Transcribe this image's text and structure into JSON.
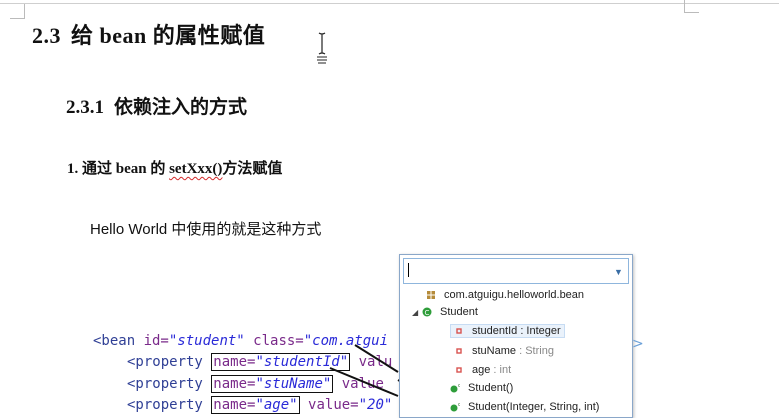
{
  "doc": {
    "heading1": {
      "num": "2.3",
      "text": "给 bean 的属性赋值"
    },
    "heading2": {
      "num": "2.3.1",
      "text": "依赖注入的方式"
    },
    "heading3": {
      "prefix": "1. 通过 bean 的 ",
      "method": "setXxx()",
      "suffix": "方法赋值"
    },
    "paragraph": "Hello World 中使用的就是这种方式"
  },
  "code": {
    "line1": {
      "open": "<bean ",
      "attr1": "id=",
      "val1": "\"student\"",
      "attr2": " class=",
      "val2": "\"com.atgui"
    },
    "line2": {
      "open": "<property ",
      "attr": "name=",
      "val": "\"studentId\"",
      "rest": " valu"
    },
    "line3": {
      "open": "<property ",
      "attr": "name=",
      "val": "\"stuName\"",
      "rest": " value"
    },
    "line4": {
      "open": "<property ",
      "attr": "name=",
      "val": "\"age\"",
      "rest": " value=",
      "val2": "\"20\""
    }
  },
  "popup": {
    "search_value": "",
    "items": [
      {
        "label": "com.atguigu.helloworld.bean",
        "icon": "package-icon"
      },
      {
        "label": "Student",
        "icon": "class-icon"
      },
      {
        "name": "studentId",
        "type": " : Integer",
        "icon": "private-field-icon"
      },
      {
        "name": "stuName",
        "type": " : String",
        "icon": "private-field-icon"
      },
      {
        "name": "age",
        "type": " : int",
        "icon": "private-field-icon"
      },
      {
        "label": "Student()",
        "icon": "constructor-icon"
      },
      {
        "label": "Student(Integer, String, int)",
        "icon": "constructor-icon"
      }
    ]
  },
  "colors": {
    "code_tag": "#2f3f95",
    "code_attr": "#7a2a8a",
    "code_string": "#2a2ad8",
    "field_icon": "#d9534f",
    "method_icon": "#2e9d3a",
    "popup_border": "#8aa7c9"
  }
}
